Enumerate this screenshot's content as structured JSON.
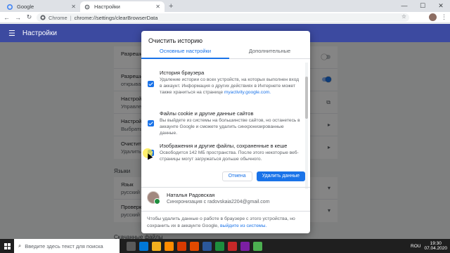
{
  "browser": {
    "tabs": [
      {
        "label": "Google",
        "active": false
      },
      {
        "label": "Настройки",
        "active": true
      }
    ],
    "address": {
      "host": "Chrome",
      "path": "chrome://settings/clearBrowserData"
    }
  },
  "settings": {
    "header_title": "Настройки",
    "bg_rows": [
      {
        "title": "Разрешит",
        "subtitle": ""
      },
      {
        "title": "Разрешит",
        "subtitle": "открыва"
      },
      {
        "title": "Настройк",
        "subtitle": "Управлен"
      },
      {
        "title": "Настройк",
        "subtitle": "Выбрать"
      },
      {
        "title": "Очистить",
        "subtitle": "Удалить"
      }
    ],
    "section_languages": "Языки",
    "lang_rows": [
      {
        "title": "Язык",
        "subtitle": "русский"
      },
      {
        "title": "Проверка",
        "subtitle": "русский"
      }
    ],
    "section_downloads": "Скачанные файлы"
  },
  "dialog": {
    "title": "Очистить историю",
    "tab_basic": "Основные настройки",
    "tab_advanced": "Дополнительные",
    "options": [
      {
        "title": "История браузера",
        "desc": "Удаление истории со всех устройств, на которых выполнен вход в аккаунт. Информация о других действиях в Интернете может также храниться на странице",
        "link": "myactivity.google.com.",
        "checked": true
      },
      {
        "title": "Файлы cookie и другие данные сайтов",
        "desc": "Вы выйдете из системы на большинстве сайтов, но останетесь в аккаунте Google и сможете удалить синхронизированные данные.",
        "link": "",
        "checked": true
      },
      {
        "title": "Изображения и другие файлы, сохраненные в кеше",
        "desc": "Освободится 142 МБ пространства. После этого некоторые веб-страницы могут загружаться дольше обычного.",
        "link": "",
        "checked": true
      }
    ],
    "cancel_label": "Отмена",
    "clear_label": "Удалить данные",
    "account": {
      "name": "Наталья Радовская",
      "sync": "Синхронизация с radovskaia2204@gmail.com"
    },
    "footer_text": "Чтобы удалить данные о работе в браузере с этого устройства, но сохранить их в аккаунте Google,",
    "footer_link": "выйдите из системы."
  },
  "taskbar": {
    "search_placeholder": "Введите здесь текст для поиска",
    "lang": "ROU",
    "time": "19:30",
    "date": "07.04.2020"
  },
  "colors": {
    "accent": "#1a73e8",
    "header": "#3c4aa0"
  },
  "icons": {
    "tab_google": "google-icon",
    "tab_settings": "gear-icon",
    "omnibox": "chrome-icon"
  }
}
